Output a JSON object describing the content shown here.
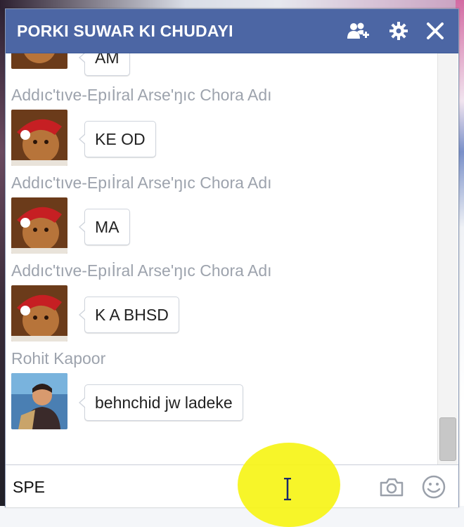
{
  "chat": {
    "title": "PORKI SUWAR KI CHUDAYI",
    "header_icons": [
      "add-friends-icon",
      "gear-icon",
      "close-icon"
    ],
    "messages": [
      {
        "sender": "",
        "text": "AM"
      },
      {
        "sender": "Addıc'tıve-Epıİral Arse'ŋıc Chora Adı",
        "text": "KE OD"
      },
      {
        "sender": "Addıc'tıve-Epıİral Arse'ŋıc Chora Adı",
        "text": "MA"
      },
      {
        "sender": "Addıc'tıve-Epıİral Arse'ŋıc Chora Adı",
        "text": "K A BHSD"
      },
      {
        "sender": "Rohit Kapoor",
        "text": "behnchid jw ladeke"
      }
    ],
    "input_value": "SPE",
    "footer_icons": [
      "camera-icon",
      "smiley-icon"
    ]
  },
  "colors": {
    "header": "#4c66a4",
    "highlight": "#f6f417"
  }
}
